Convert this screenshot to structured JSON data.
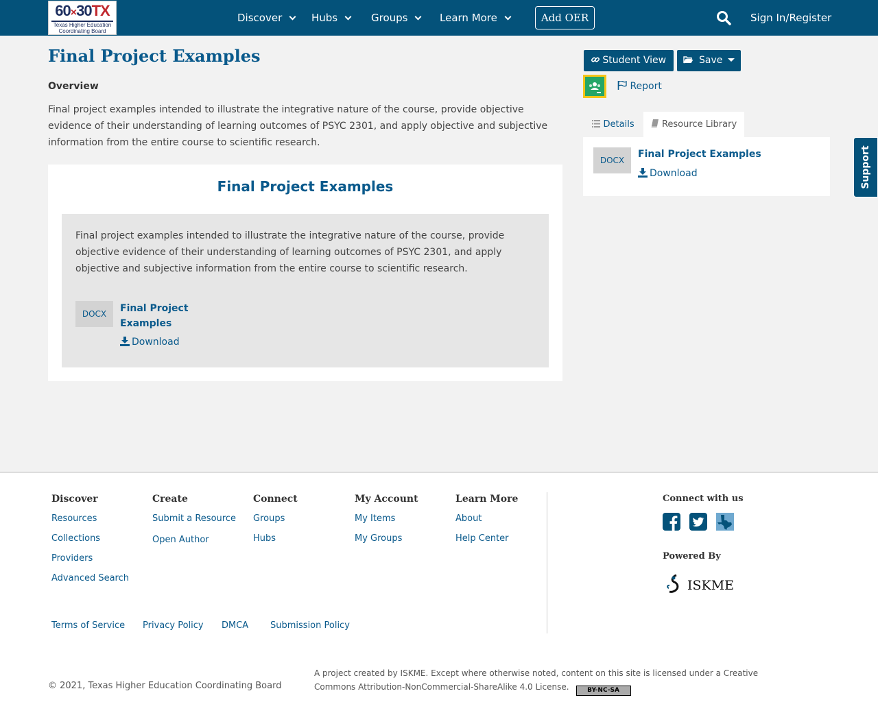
{
  "header": {
    "logo": {
      "big": "60x30TX",
      "line1": "Texas Higher Education",
      "line2": "Coordinating Board"
    },
    "nav": [
      {
        "label": "Discover"
      },
      {
        "label": "Hubs"
      },
      {
        "label": "Groups"
      },
      {
        "label": "Learn More"
      }
    ],
    "add_oer": "Add OER",
    "signin": "Sign In/Register"
  },
  "page": {
    "title": "Final Project Examples",
    "overview_label": "Overview",
    "overview_text": "Final project examples intended to illustrate the integrative nature of the course, provide objective evidence of their understanding of learning outcomes of PSYC 2301, and apply objective and subjective information from the entire course to scientific research."
  },
  "card": {
    "title": "Final Project Examples",
    "description": "Final project examples intended to illustrate the integrative nature of the course, provide objective evidence of their understanding of learning outcomes of PSYC 2301, and apply objective and subjective information from the entire course to scientific research.",
    "resource": {
      "type": "DOCX",
      "title": "Final Project Examples",
      "download": "Download"
    }
  },
  "sidebar": {
    "student_view": "Student View",
    "save": "Save",
    "report": "Report",
    "tabs": [
      {
        "label": "Details"
      },
      {
        "label": "Resource Library"
      }
    ],
    "resource": {
      "type": "DOCX",
      "title": "Final Project Examples",
      "download": "Download"
    }
  },
  "support": "Support",
  "footer": {
    "columns": [
      {
        "heading": "Discover",
        "links": [
          "Resources",
          "Collections",
          "Providers",
          "Advanced Search"
        ]
      },
      {
        "heading": "Create",
        "links": [
          "Submit a Resource",
          "Open Author"
        ]
      },
      {
        "heading": "Connect",
        "links": [
          "Groups",
          "Hubs"
        ]
      },
      {
        "heading": "My Account",
        "links": [
          "My Items",
          "My Groups"
        ]
      },
      {
        "heading": "Learn More",
        "links": [
          "About",
          "Help Center"
        ]
      }
    ],
    "policies": [
      "Terms of Service",
      "Privacy Policy",
      "DMCA",
      "Submission Policy"
    ],
    "connect_heading": "Connect with us",
    "powered_heading": "Powered By",
    "iskme": "ISKME",
    "copyright": "© 2021, Texas Higher Education Coordinating Board",
    "license_text": "A project created by ISKME. Except where otherwise noted, content on this site is licensed under a Creative Commons Attribution-NonCommercial-ShareAlike 4.0 License.",
    "cc_badge": "BY-NC-SA"
  },
  "colors": {
    "primary": "#04527a",
    "link": "#0a5a8c",
    "background": "#f2f2f2",
    "classroom_yellow": "#f5c518",
    "classroom_green": "#25a667"
  }
}
